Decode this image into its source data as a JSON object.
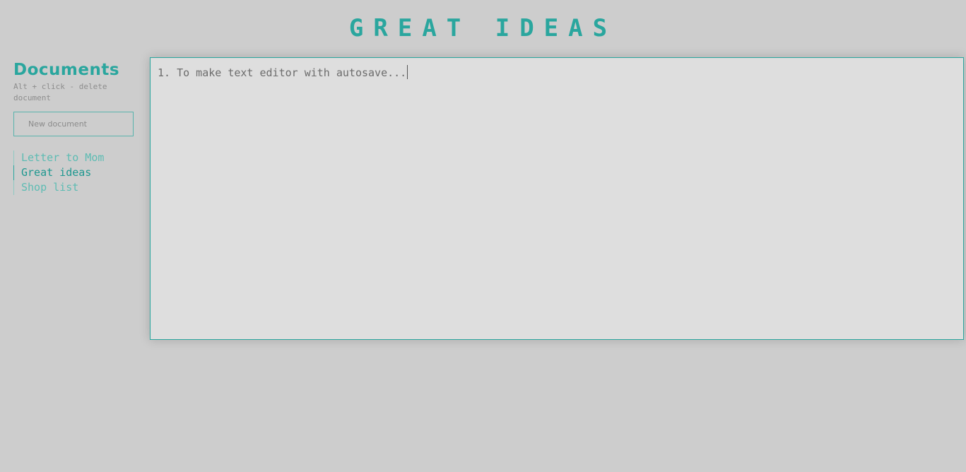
{
  "header": {
    "title": "GREAT IDEAS"
  },
  "sidebar": {
    "heading": "Documents",
    "hint": "Alt + click - delete document",
    "new_document_placeholder": "New document",
    "documents": [
      {
        "label": "Letter to Mom",
        "active": false
      },
      {
        "label": "Great ideas",
        "active": true
      },
      {
        "label": "Shop list",
        "active": false
      }
    ]
  },
  "editor": {
    "content": "1. To make text editor with autosave..."
  },
  "colors": {
    "accent": "#2aa69e",
    "background": "#cdcdcd",
    "editor_background": "#dedede"
  }
}
